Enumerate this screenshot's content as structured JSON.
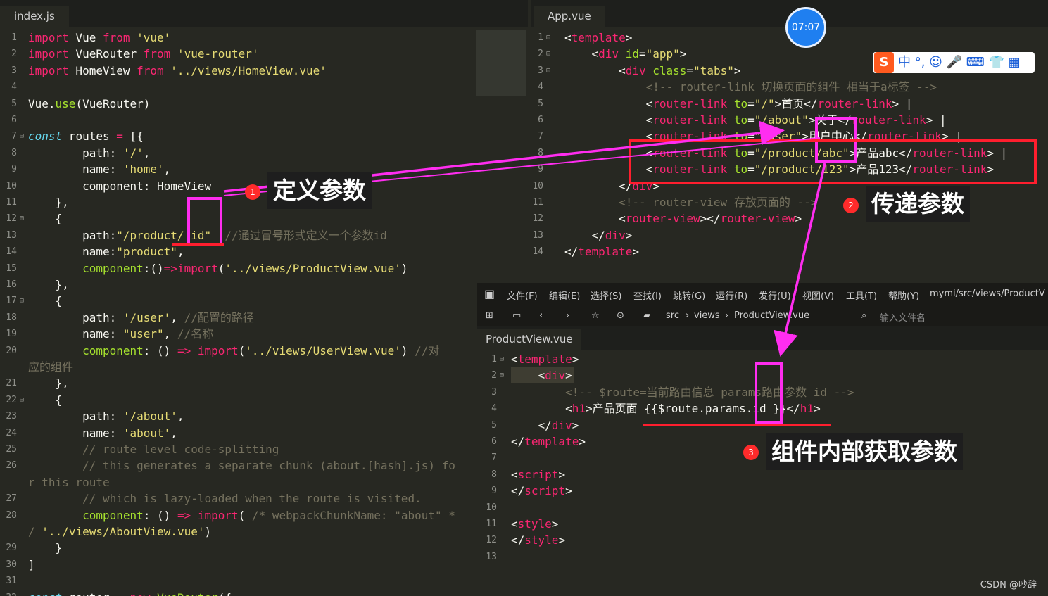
{
  "left_tab": "index.js",
  "right_tab": "App.vue",
  "bottom_tab": "ProductView.vue",
  "timer": "07:07",
  "watermark": "CSDN @吵辞",
  "ime_bar": "中 °, ☺ 🎤 ⌨ 👕 ▦",
  "menu": [
    "文件(F)",
    "编辑(E)",
    "选择(S)",
    "查找(I)",
    "跳转(G)",
    "运行(R)",
    "发行(U)",
    "视图(V)",
    "工具(T)",
    "帮助(Y)",
    "mymi/src/views/ProductV"
  ],
  "breadcrumb": [
    "src",
    "views",
    "ProductView.vue"
  ],
  "file_search_placeholder": "输入文件名",
  "labels": {
    "define": "定义参数",
    "pass": "传递参数",
    "get": "组件内部获取参数",
    "n1": "1",
    "n2": "2",
    "n3": "3"
  },
  "colors": {
    "magenta": "#ff2df0",
    "red": "#ff1e2e",
    "editor_bg": "#272822"
  }
}
